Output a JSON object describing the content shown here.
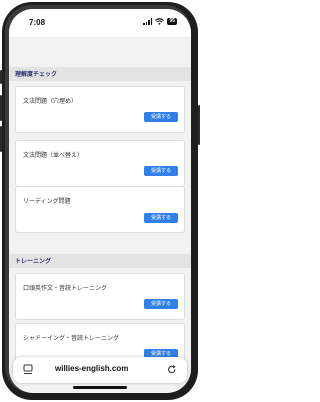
{
  "status_bar": {
    "time": "7:08",
    "battery": "95"
  },
  "sections": [
    {
      "title": "理解度チェック",
      "courses": [
        {
          "title": "文法問題（穴埋め）",
          "button": "受講する"
        },
        {
          "title": "文法問題（並べ替え）",
          "button": "受講する"
        },
        {
          "title": "リーディング問題",
          "button": "受講する"
        }
      ]
    },
    {
      "title": "トレーニング",
      "courses": [
        {
          "title": "口頭英作文・音読トレーニング",
          "button": "受講する"
        },
        {
          "title": "シャドーイング・音読トレーニング",
          "button": "受講する"
        }
      ]
    }
  ],
  "browser": {
    "url": "willies-english.com",
    "tabs_icon": "tabs-icon",
    "reload_icon": "reload-icon"
  },
  "colors": {
    "accent": "#2f80e8",
    "section_title": "#2a2f6e"
  }
}
